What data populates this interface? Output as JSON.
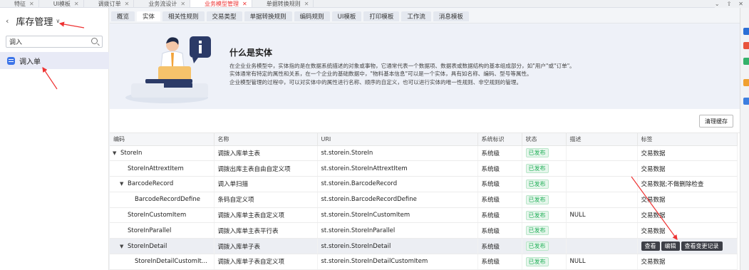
{
  "top_tabs": [
    {
      "label": "特征",
      "active": false
    },
    {
      "label": "UI模板",
      "active": false
    },
    {
      "label": "调拨订单",
      "active": false
    },
    {
      "label": "业务流设计",
      "active": false
    },
    {
      "label": "业务模型管理",
      "active": true
    },
    {
      "label": "单据转换规则",
      "active": false
    }
  ],
  "sidebar": {
    "title": "库存管理",
    "search_value": "调入",
    "items": [
      {
        "label": "调入单",
        "selected": true
      }
    ]
  },
  "sub_tabs": [
    {
      "label": "概览",
      "active": false
    },
    {
      "label": "实体",
      "active": true
    },
    {
      "label": "相关性规则",
      "active": false
    },
    {
      "label": "交易类型",
      "active": false
    },
    {
      "label": "单据转换规则",
      "active": false
    },
    {
      "label": "编码规则",
      "active": false
    },
    {
      "label": "UI模板",
      "active": false
    },
    {
      "label": "打印模板",
      "active": false
    },
    {
      "label": "工作流",
      "active": false
    },
    {
      "label": "消息模板",
      "active": false
    }
  ],
  "banner": {
    "title": "什么是实体",
    "lines": [
      "在企业业务模型中，实体指的是在数据系统描述的对象或事物，它通常代表一个数据项、数据表或数据结构的基本组成部分，如\"用户\"或\"订单\"。",
      "实体通常有特定的属性和关系，在一个企业的基础数据中，\"物料基本信息\"可以是一个实体，具有如名称、编码、型号等属性。",
      "企业模型管理的过程中，可以对实体中的属性进行名称、顺序的自定义，也可以进行实体的唯一性规则、非空规则的管理。"
    ]
  },
  "toolbar": {
    "clear_cache": "清理缓存"
  },
  "table": {
    "columns": [
      "编码",
      "名称",
      "URI",
      "系统标识",
      "状态",
      "描述",
      "标签"
    ],
    "rows": [
      {
        "code": "StoreIn",
        "name": "调拨入库单主表",
        "uri": "st.storein.StoreIn",
        "sys": "系统级",
        "status": "已发布",
        "desc": "",
        "tag": "交易数据",
        "level": 0,
        "expand": "▼",
        "hl": false
      },
      {
        "code": "StoreInAttrextItem",
        "name": "调拨出库主表自由自定义项",
        "uri": "st.storein.StoreInAttrextItem",
        "sys": "系统级",
        "status": "已发布",
        "desc": "",
        "tag": "交易数据",
        "level": 1,
        "expand": "",
        "hl": false
      },
      {
        "code": "BarcodeRecord",
        "name": "调入单扫描",
        "uri": "st.storein.BarcodeRecord",
        "sys": "系统级",
        "status": "已发布",
        "desc": "",
        "tag": "交易数据;不做删除检查",
        "level": 1,
        "expand": "▼",
        "hl": false
      },
      {
        "code": "BarcodeRecordDefine",
        "name": "条码自定义项",
        "uri": "st.storein.BarcodeRecordDefine",
        "sys": "系统级",
        "status": "已发布",
        "desc": "",
        "tag": "交易数据",
        "level": 2,
        "expand": "",
        "hl": false
      },
      {
        "code": "StoreInCustomItem",
        "name": "调拨入库单主表自定义项",
        "uri": "st.storein.StoreInCustomItem",
        "sys": "系统级",
        "status": "已发布",
        "desc": "NULL",
        "tag": "交易数据",
        "level": 1,
        "expand": "",
        "hl": false
      },
      {
        "code": "StoreInParallel",
        "name": "调拨入库单主表平行表",
        "uri": "st.storein.StoreInParallel",
        "sys": "系统级",
        "status": "已发布",
        "desc": "",
        "tag": "交易数据",
        "level": 1,
        "expand": "",
        "hl": false
      },
      {
        "code": "StoreInDetail",
        "name": "调拨入库单子表",
        "uri": "st.storein.StoreInDetail",
        "sys": "系统级",
        "status": "已发布",
        "desc": "",
        "tag": "",
        "level": 1,
        "expand": "▼",
        "hl": true
      },
      {
        "code": "StoreInDetailCustomIt...",
        "name": "调拨入库单子表自定义项",
        "uri": "st.storein.StoreInDetailCustomItem",
        "sys": "系统级",
        "status": "已发布",
        "desc": "NULL",
        "tag": "交易数据",
        "level": 2,
        "expand": "",
        "hl": false
      }
    ],
    "row_actions": [
      "查看",
      "编辑",
      "查看变更记录"
    ]
  },
  "colors": {
    "accent": "#e33333",
    "status_green": "#24b05a",
    "highlight_row": "#eceef3",
    "action_btn": "#3d3f47"
  }
}
